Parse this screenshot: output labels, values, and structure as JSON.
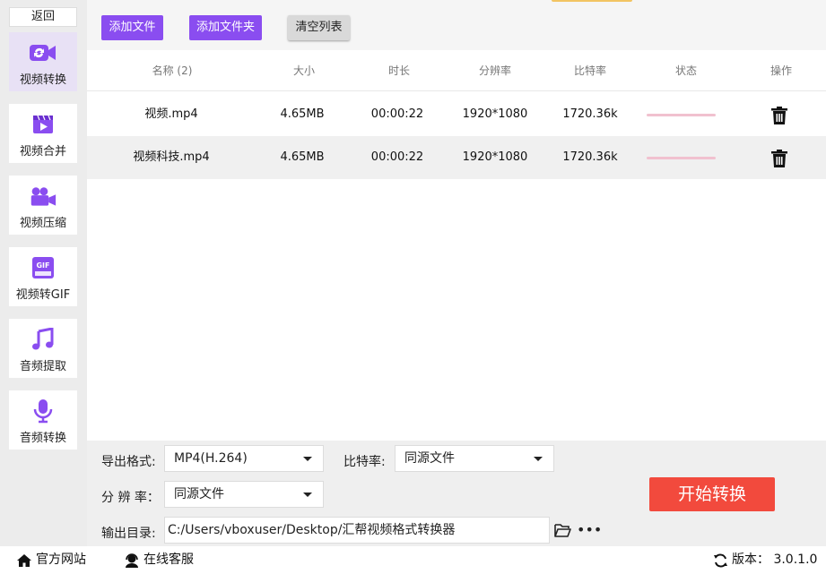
{
  "sidebar": {
    "back_label": "返回",
    "items": [
      {
        "label": "视频转换",
        "icon": "video-convert-icon"
      },
      {
        "label": "视频合并",
        "icon": "video-merge-icon"
      },
      {
        "label": "视频压缩",
        "icon": "video-compress-icon"
      },
      {
        "label": "视频转GIF",
        "icon": "gif-icon"
      },
      {
        "label": "音频提取",
        "icon": "music-note-icon"
      },
      {
        "label": "音频转换",
        "icon": "microphone-icon"
      }
    ]
  },
  "toolbar": {
    "add_file": "添加文件",
    "add_folder": "添加文件夹",
    "clear_list": "清空列表"
  },
  "table": {
    "headers": [
      "名称 (2)",
      "大小",
      "时长",
      "分辨率",
      "比特率",
      "状态",
      "操作"
    ],
    "rows": [
      {
        "name": "视频.mp4",
        "size": "4.65MB",
        "duration": "00:00:22",
        "resolution": "1920*1080",
        "bitrate": "1720.36k",
        "progress": 0
      },
      {
        "name": "视频科技.mp4",
        "size": "4.65MB",
        "duration": "00:00:22",
        "resolution": "1920*1080",
        "bitrate": "1720.36k",
        "progress": 0
      }
    ]
  },
  "settings": {
    "format_label": "导出格式:",
    "format_value": "MP4(H.264)",
    "bitrate_label": "比特率:",
    "bitrate_value": "同源文件",
    "resolution_label": "分 辨 率：",
    "resolution_value": "同源文件",
    "output_label": "输出目录:",
    "output_path": "C:/Users/vboxuser/Desktop/汇帮视频格式转换器",
    "start_label": "开始转换"
  },
  "footer": {
    "website": "官方网站",
    "support": "在线客服",
    "version": "版本： 3.0.1.0"
  },
  "colors": {
    "accent": "#8a4df0",
    "start": "#f24a3d",
    "progress": "#f1c1cf"
  }
}
